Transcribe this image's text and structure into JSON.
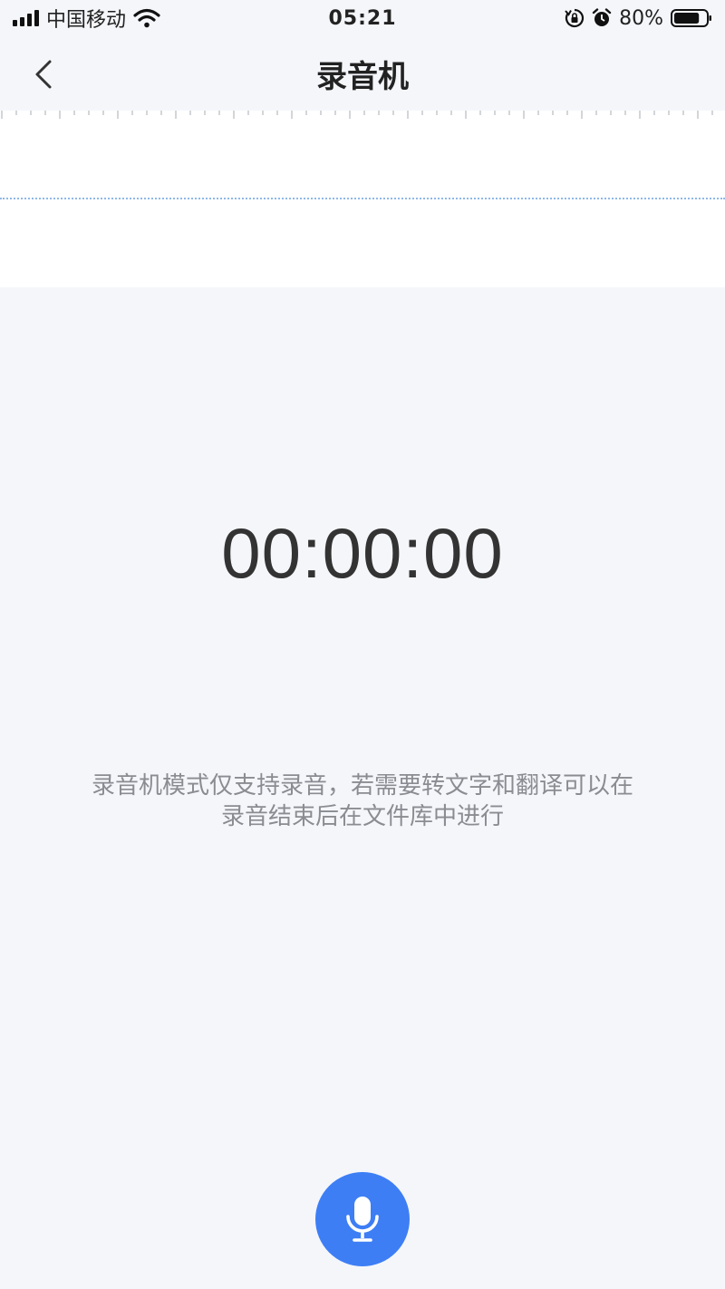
{
  "status_bar": {
    "carrier": "中国移动",
    "time": "05:21",
    "battery_percent": "80%",
    "battery_level": 0.8,
    "icons": [
      "signal-icon",
      "wifi-icon",
      "orientation-lock-icon",
      "alarm-icon",
      "battery-icon"
    ]
  },
  "nav": {
    "title": "录音机",
    "back_icon": "chevron-left-icon"
  },
  "recorder": {
    "timer": "00:00:00",
    "hint_line1": "录音机模式仅支持录音，若需要转文字和翻译可以在",
    "hint_line2": "录音结束后在文件库中进行",
    "record_icon": "microphone-icon"
  },
  "colors": {
    "accent": "#3d7ef5",
    "background": "#f4f6fa",
    "wave_line": "#8fb8e8"
  }
}
